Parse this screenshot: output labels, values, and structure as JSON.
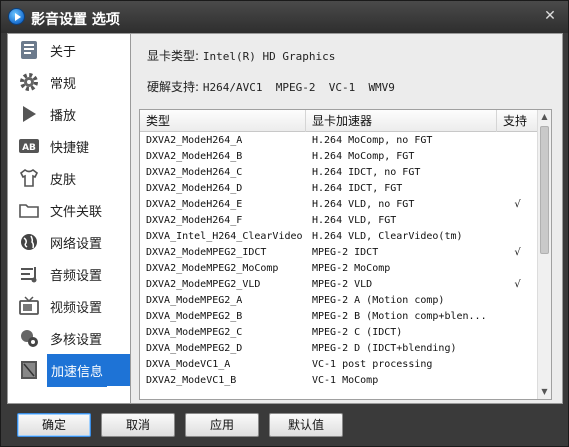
{
  "window": {
    "title": "影音设置 选项"
  },
  "sidebar": {
    "items": [
      {
        "label": "关于",
        "icon": "about-icon"
      },
      {
        "label": "常规",
        "icon": "gear-icon"
      },
      {
        "label": "播放",
        "icon": "play-icon"
      },
      {
        "label": "快捷键",
        "icon": "keyboard-icon"
      },
      {
        "label": "皮肤",
        "icon": "shirt-icon"
      },
      {
        "label": "文件关联",
        "icon": "folder-icon"
      },
      {
        "label": "网络设置",
        "icon": "globe-icon"
      },
      {
        "label": "音频设置",
        "icon": "audio-icon"
      },
      {
        "label": "视频设置",
        "icon": "tv-icon"
      },
      {
        "label": "多核设置",
        "icon": "cpu-icon"
      },
      {
        "label": "加速信息",
        "icon": "chip-icon",
        "active": true
      }
    ]
  },
  "info": {
    "gpu_label": "显卡类型:",
    "gpu_value": "Intel(R) HD Graphics",
    "hw_label": "硬解支持:",
    "hw_value": "H264/AVC1  MPEG-2  VC-1  WMV9"
  },
  "table": {
    "headers": [
      "类型",
      "显卡加速器",
      "支持"
    ],
    "rows": [
      [
        "DXVA2_ModeH264_A",
        "H.264 MoComp, no FGT",
        ""
      ],
      [
        "DXVA2_ModeH264_B",
        "H.264 MoComp, FGT",
        ""
      ],
      [
        "DXVA2_ModeH264_C",
        "H.264 IDCT, no FGT",
        ""
      ],
      [
        "DXVA2_ModeH264_D",
        "H.264 IDCT, FGT",
        ""
      ],
      [
        "DXVA2_ModeH264_E",
        "H.264 VLD, no FGT",
        "√"
      ],
      [
        "DXVA2_ModeH264_F",
        "H.264 VLD, FGT",
        ""
      ],
      [
        "DXVA_Intel_H264_ClearVideo",
        "H.264 VLD, ClearVideo(tm)",
        ""
      ],
      [
        "DXVA2_ModeMPEG2_IDCT",
        "MPEG-2 IDCT",
        "√"
      ],
      [
        "DXVA2_ModeMPEG2_MoComp",
        "MPEG-2 MoComp",
        ""
      ],
      [
        "DXVA2_ModeMPEG2_VLD",
        "MPEG-2 VLD",
        "√"
      ],
      [
        "DXVA_ModeMPEG2_A",
        "MPEG-2 A (Motion comp)",
        ""
      ],
      [
        "DXVA_ModeMPEG2_B",
        "MPEG-2 B (Motion comp+blen...",
        ""
      ],
      [
        "DXVA_ModeMPEG2_C",
        "MPEG-2 C (IDCT)",
        ""
      ],
      [
        "DXVA_ModeMPEG2_D",
        "MPEG-2 D (IDCT+blending)",
        ""
      ],
      [
        "DXVA_ModeVC1_A",
        "VC-1 post processing",
        ""
      ],
      [
        "DXVA2_ModeVC1_B",
        "VC-1 MoComp",
        ""
      ]
    ]
  },
  "buttons": {
    "ok": "确定",
    "cancel": "取消",
    "apply": "应用",
    "default": "默认值"
  },
  "colors": {
    "accent": "#1e73d6",
    "window_bg": "#3a3a3a"
  }
}
